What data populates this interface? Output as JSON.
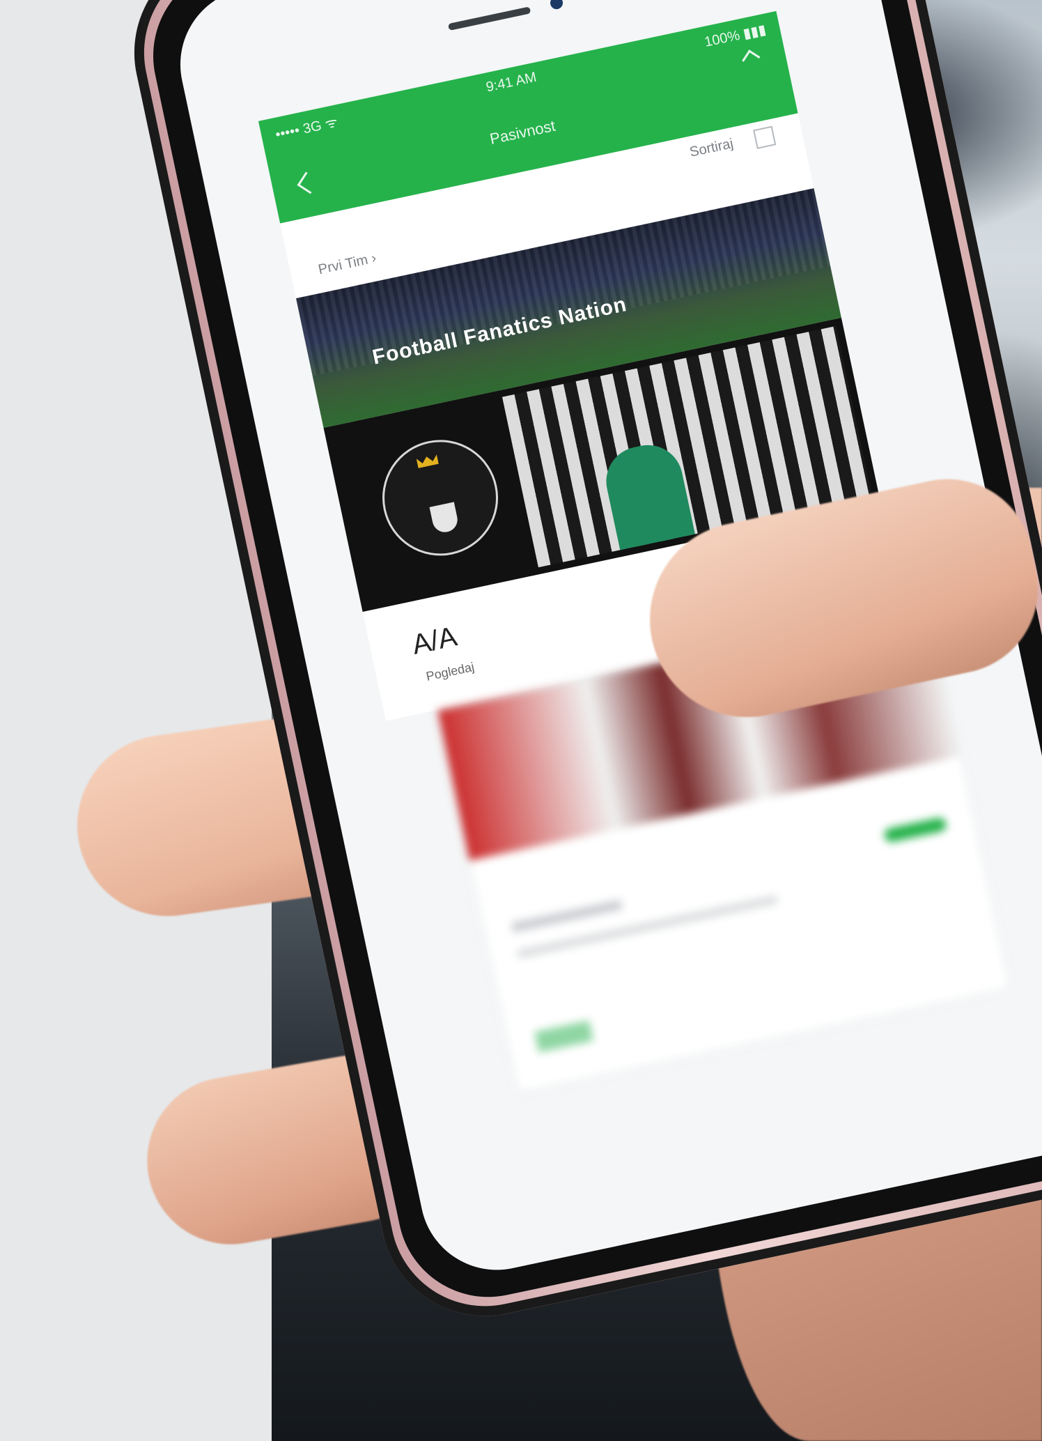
{
  "app": {
    "status_bar": {
      "carrier": "••••• 3G ᯤ",
      "time": "9:41 AM",
      "battery": "100% ▮▮▮"
    },
    "header_title": "Pasivnost",
    "filter_bar": {
      "breadcrumb": "Prvi Tim  ›",
      "sort_label": "Sortiraj"
    },
    "banner_hero_text": "Football Fanatics Nation",
    "section": {
      "title": "A/A",
      "subtitle": "Pogledaj"
    }
  },
  "colors": {
    "accent_green": "#25b24b",
    "phone_frame": "#d9b0b0",
    "background_left": "#e6e8ea"
  },
  "icons": [
    "back-icon",
    "share-icon",
    "grid-icon",
    "crown-icon",
    "shield-icon"
  ]
}
